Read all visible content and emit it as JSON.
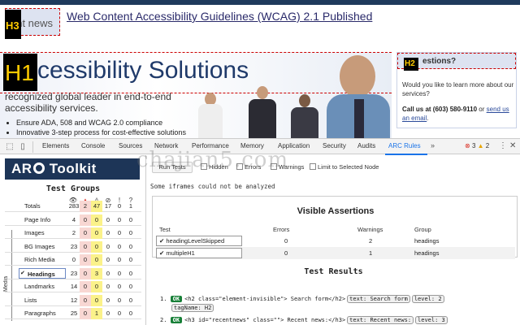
{
  "site": {
    "news_label": "ent news",
    "news_headline": "Web Content Accessibility Guidelines (WCAG) 2.1 Published",
    "h3_badge": "H3",
    "h1_badge": "H1",
    "hero_title": "cessibility Solutions",
    "hero_subtitle": "recognized global leader in end-to-end accessibility services.",
    "hero_bullets": [
      "Ensure ADA, 508 and WCAG 2.0 compliance",
      "Innovative 3-step process for cost-effective solutions"
    ],
    "side_h2_badge": "H2",
    "side_title": "estions?",
    "side_text": "Would you like to learn more about our services?",
    "side_call_bold": "Call us at (603) 580-9110",
    "side_call_or": "or",
    "side_call_link1": "send us",
    "side_call_link2": "an email",
    "side_call_end": "."
  },
  "devtools": {
    "tabs": [
      "Elements",
      "Console",
      "Sources",
      "Network",
      "Performance",
      "Memory",
      "Application",
      "Security",
      "Audits",
      "ARC Rules"
    ],
    "active_tab": "ARC Rules",
    "more": "»",
    "errors": "3",
    "warnings": "2"
  },
  "arc": {
    "logo_a": "AR",
    "logo_b": "Toolkit",
    "test_groups_title": "Test Groups",
    "media_label": "Media",
    "groups": [
      {
        "label": "Totals",
        "v": [
          "283",
          "2",
          "47",
          "17",
          "0",
          "1"
        ],
        "selected": false
      },
      {
        "label": "Page Info",
        "v": [
          "4",
          "0",
          "0",
          "0",
          "0",
          "0"
        ],
        "selected": false
      },
      {
        "label": "Images",
        "v": [
          "2",
          "0",
          "0",
          "0",
          "0",
          "0"
        ],
        "selected": false
      },
      {
        "label": "BG Images",
        "v": [
          "23",
          "0",
          "0",
          "0",
          "0",
          "0"
        ],
        "selected": false
      },
      {
        "label": "Rich Media",
        "v": [
          "0",
          "0",
          "0",
          "0",
          "0",
          "0"
        ],
        "selected": false
      },
      {
        "label": "Headings",
        "v": [
          "23",
          "0",
          "3",
          "0",
          "0",
          "0"
        ],
        "selected": true
      },
      {
        "label": "Landmarks",
        "v": [
          "14",
          "0",
          "0",
          "0",
          "0",
          "0"
        ],
        "selected": false
      },
      {
        "label": "Lists",
        "v": [
          "12",
          "0",
          "0",
          "0",
          "0",
          "0"
        ],
        "selected": false
      },
      {
        "label": "Paragraphs",
        "v": [
          "25",
          "0",
          "1",
          "0",
          "0",
          "0"
        ],
        "selected": false
      }
    ],
    "toolbar": {
      "run_tests": "Run Tests",
      "hidden": "Hidden",
      "errors": "Errors",
      "warnings": "Warnings",
      "limit": "Limit to Selected Node"
    },
    "iframe_note": "Some iframes could not be analyzed",
    "visible_assertions": {
      "title": "Visible Assertions",
      "headers": [
        "Test",
        "Errors",
        "Warnings",
        "Group"
      ],
      "rows": [
        {
          "test": "headingLevelSkipped",
          "errors": "0",
          "warnings": "2",
          "group": "headings"
        },
        {
          "test": "multipleH1",
          "errors": "0",
          "warnings": "1",
          "group": "headings"
        }
      ]
    },
    "test_results": {
      "title": "Test Results",
      "items": [
        {
          "num": "1.",
          "ok": "OK",
          "code": "<h2 class=\"element-invisible\"> Search form</h2>",
          "pills": [
            "text: Search form",
            "level: 2"
          ],
          "pills2": [
            "tagName: H2"
          ]
        },
        {
          "num": "2.",
          "ok": "OK",
          "code": "<h3 id=\"recentnews\" class=\"\"> Recent news:</h3>",
          "pills": [
            "text: Recent news:",
            "level: 3"
          ],
          "pills2": []
        }
      ]
    }
  },
  "watermark": "chajian5.com",
  "colors": {
    "accent": "#1a73e8",
    "logo_bg": "#1d3557",
    "error_bg": "#f8d7d3",
    "warning_bg": "#fbf28a",
    "ok": "#188038"
  }
}
